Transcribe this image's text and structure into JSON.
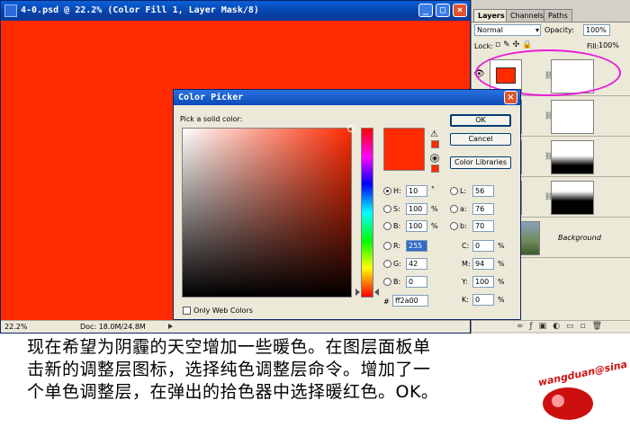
{
  "document": {
    "title": "4-0.psd @ 22.2% (Color Fill 1, Layer Mask/8)",
    "zoom": "22.2%",
    "info": "Doc: 18.0M/24.8M",
    "fill_color": "#ff2a00"
  },
  "layers_panel": {
    "tabs": [
      "Layers",
      "Channels",
      "Paths"
    ],
    "blend_mode": "Normal",
    "opacity_label": "Opacity:",
    "opacity": "100%",
    "lock_label": "Lock:",
    "fill_label": "Fill:",
    "fill": "100%",
    "layers": [
      {
        "name": "",
        "thumb_color": "#ff2a00"
      },
      {
        "name": ""
      },
      {
        "name": ""
      },
      {
        "name": ""
      },
      {
        "name": "Background"
      }
    ],
    "highlight_color": "#e81fd8"
  },
  "color_picker": {
    "title": "Color Picker",
    "pick_label": "Pick a solid color:",
    "buttons": {
      "ok": "OK",
      "cancel": "Cancel",
      "libraries": "Color Libraries"
    },
    "fields": {
      "H": "10",
      "S": "100",
      "B": "100",
      "R": "255",
      "G": "42",
      "Bl": "0",
      "L": "56",
      "a": "76",
      "b": "70",
      "C": "0",
      "M": "94",
      "Y": "100",
      "K": "0"
    },
    "units": {
      "deg": "°",
      "pct": "%"
    },
    "hex_label": "#",
    "hex": "ff2a00",
    "web_colors_label": "Only Web Colors",
    "selected_color": "#ff2a00"
  },
  "caption": {
    "line1": "现在希望为阴霾的天空增加一些暖色。在图层面板单",
    "line2": "击新的调整层图标，选择纯色调整层命令。增加了一",
    "line3": "个单色调整层，在弹出的拾色器中选择暖红色。OK。"
  },
  "logo": {
    "text": "wangduan@sina"
  }
}
